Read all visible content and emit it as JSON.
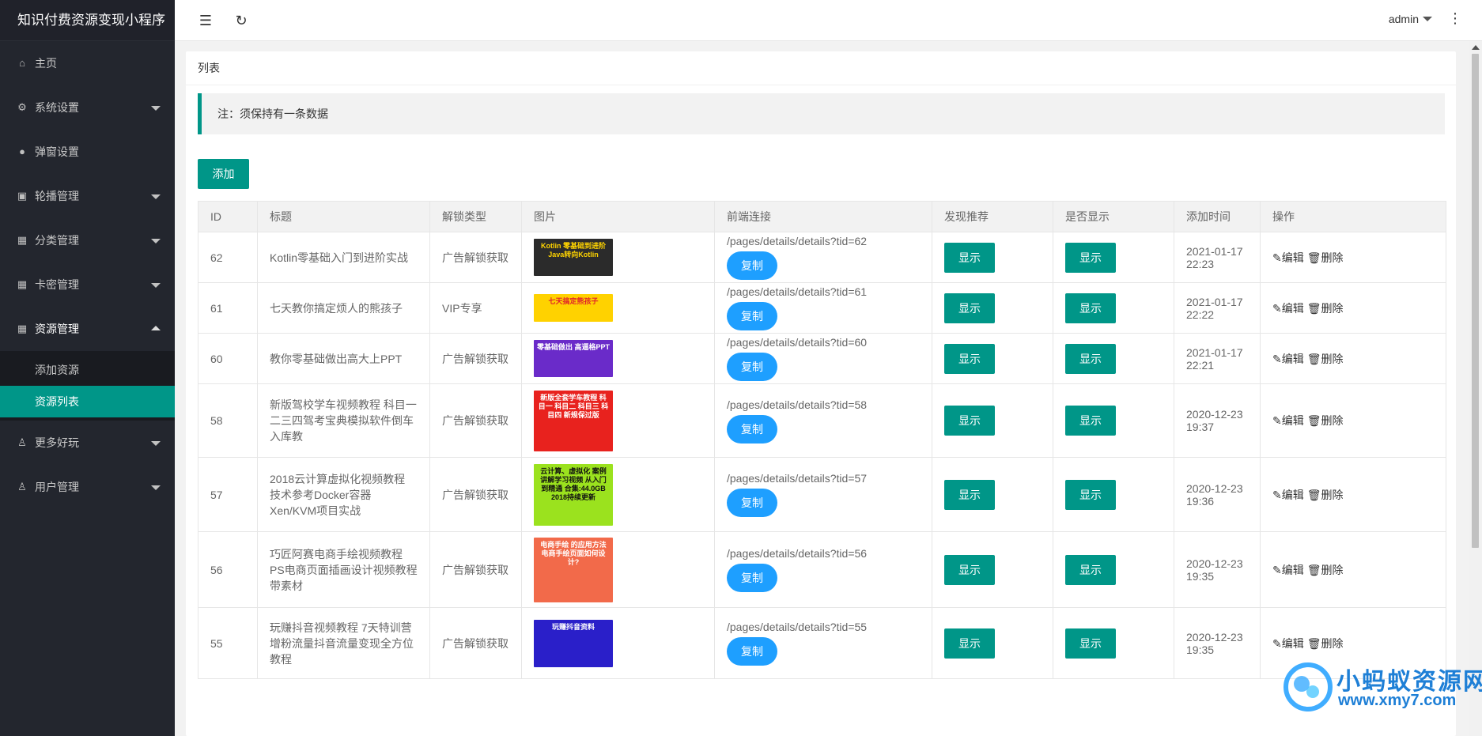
{
  "app": {
    "title": "知识付费资源变现小程序"
  },
  "sidebar": {
    "items": [
      {
        "label": "主页",
        "icon": "home-icon"
      },
      {
        "label": "系统设置",
        "icon": "gear-icon"
      },
      {
        "label": "弹窗设置",
        "icon": "dot-icon"
      },
      {
        "label": "轮播管理",
        "icon": "image-icon"
      },
      {
        "label": "分类管理",
        "icon": "grid-icon"
      },
      {
        "label": "卡密管理",
        "icon": "grid-icon"
      },
      {
        "label": "资源管理",
        "icon": "grid-icon"
      },
      {
        "label": "更多好玩",
        "icon": "user-icon"
      },
      {
        "label": "用户管理",
        "icon": "user-icon"
      }
    ],
    "sub_items": [
      {
        "label": "添加资源"
      },
      {
        "label": "资源列表"
      }
    ]
  },
  "topbar": {
    "user": "admin"
  },
  "card": {
    "title": "列表",
    "note": "注：须保持有一条数据",
    "add_label": "添加"
  },
  "table": {
    "headers": [
      "ID",
      "标题",
      "解锁类型",
      "图片",
      "前端连接",
      "发现推荐",
      "是否显示",
      "添加时间",
      "操作"
    ],
    "copy_label": "复制",
    "show_label": "显示",
    "edit_label": "编辑",
    "delete_label": "删除",
    "rows": [
      {
        "id": "62",
        "title": "Kotlin零基础入门到进阶实战",
        "unlock": "广告解锁获取",
        "link": "/pages/details/details?tid=62",
        "date": "2021-01-17",
        "time": "22:23",
        "img_text": "Kotlin 零基础到进阶 Java转向Kotlin",
        "img_bg": "#2b2b2b",
        "img_fg": "#ffd400"
      },
      {
        "id": "61",
        "title": "七天教你搞定烦人的熊孩子",
        "unlock": "VIP专享",
        "link": "/pages/details/details?tid=61",
        "date": "2021-01-17",
        "time": "22:22",
        "img_text": "七天搞定熊孩子",
        "img_bg": "#ffd200",
        "img_fg": "#e0242a"
      },
      {
        "id": "60",
        "title": "教你零基础做出高大上PPT",
        "unlock": "广告解锁获取",
        "link": "/pages/details/details?tid=60",
        "date": "2021-01-17",
        "time": "22:21",
        "img_text": "零基础做出 高逼格PPT",
        "img_bg": "#6a2bc9",
        "img_fg": "#ffffff"
      },
      {
        "id": "58",
        "title": "新版驾校学车视频教程 科目一二三四驾考宝典模拟软件倒车入库教",
        "unlock": "广告解锁获取",
        "link": "/pages/details/details?tid=58",
        "date": "2020-12-23",
        "time": "19:37",
        "img_text": "新版全套学车教程 科目一 科目二 科目三 科目四 新规保过版",
        "img_bg": "#e8221e",
        "img_fg": "#ffffff"
      },
      {
        "id": "57",
        "title": "2018云计算虚拟化视频教程 技术参考Docker容器Xen/KVM项目实战",
        "unlock": "广告解锁获取",
        "link": "/pages/details/details?tid=57",
        "date": "2020-12-23",
        "time": "19:36",
        "img_text": "云计算、虚拟化 案例讲解学习视频 从入门到精通 合集:44.0GB 2018持续更新",
        "img_bg": "#9be21e",
        "img_fg": "#111111"
      },
      {
        "id": "56",
        "title": "巧匠阿赛电商手绘视频教程 PS电商页面插画设计视频教程带素材",
        "unlock": "广告解锁获取",
        "link": "/pages/details/details?tid=56",
        "date": "2020-12-23",
        "time": "19:35",
        "img_text": "电商手绘 的应用方法 电商手绘页面如何设计?",
        "img_bg": "#f26a4a",
        "img_fg": "#ffffff"
      },
      {
        "id": "55",
        "title": "玩赚抖音视频教程 7天特训营增粉流量抖音流量变现全方位教程",
        "unlock": "广告解锁获取",
        "link": "/pages/details/details?tid=55",
        "date": "2020-12-23",
        "time": "19:35",
        "img_text": "玩赚抖音资料",
        "img_bg": "#2a1fc9",
        "img_fg": "#ffffff"
      }
    ]
  },
  "watermark": {
    "title": "小蚂蚁资源网",
    "url": "www.xmy7.com"
  }
}
